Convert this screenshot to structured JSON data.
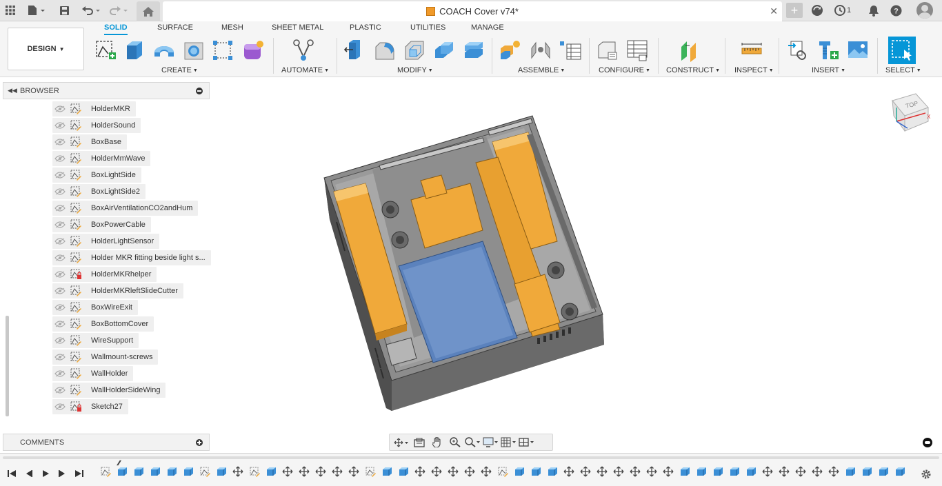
{
  "window": {
    "title": "COACH Cover v74*"
  },
  "topbar": {
    "icons": [
      "apps-grid-icon",
      "file-icon",
      "save-icon",
      "undo-icon",
      "redo-icon",
      "home-icon",
      "new-tab-icon",
      "extensions-icon",
      "job-status-icon",
      "notifications-icon",
      "help-icon",
      "avatar"
    ],
    "job_count": "1"
  },
  "ribbon": {
    "workspace": "DESIGN",
    "tabs": [
      {
        "label": "SOLID",
        "active": true
      },
      {
        "label": "SURFACE",
        "active": false
      },
      {
        "label": "MESH",
        "active": false
      },
      {
        "label": "SHEET METAL",
        "active": false
      },
      {
        "label": "PLASTIC",
        "active": false
      },
      {
        "label": "UTILITIES",
        "active": false
      },
      {
        "label": "MANAGE",
        "active": false
      }
    ],
    "groups": [
      {
        "label": "CREATE"
      },
      {
        "label": "AUTOMATE"
      },
      {
        "label": "MODIFY"
      },
      {
        "label": "ASSEMBLE"
      },
      {
        "label": "CONFIGURE"
      },
      {
        "label": "CONSTRUCT"
      },
      {
        "label": "INSPECT"
      },
      {
        "label": "INSERT"
      },
      {
        "label": "SELECT"
      }
    ]
  },
  "browser": {
    "title": "BROWSER",
    "items": [
      {
        "label": "HolderMKR",
        "locked": false
      },
      {
        "label": "HolderSound",
        "locked": false
      },
      {
        "label": "BoxBase",
        "locked": false
      },
      {
        "label": "HolderMmWave",
        "locked": false
      },
      {
        "label": "BoxLightSide",
        "locked": false
      },
      {
        "label": "BoxLightSide2",
        "locked": false
      },
      {
        "label": "BoxAirVentilationCO2andHum",
        "locked": false
      },
      {
        "label": "BoxPowerCable",
        "locked": false
      },
      {
        "label": "HolderLightSensor",
        "locked": false
      },
      {
        "label": "Holder MKR fitting beside light s...",
        "locked": false
      },
      {
        "label": "HolderMKRhelper",
        "locked": true
      },
      {
        "label": "HolderMKRleftSlideCutter",
        "locked": false
      },
      {
        "label": "BoxWireExit",
        "locked": false
      },
      {
        "label": "BoxBottomCover",
        "locked": false
      },
      {
        "label": "WireSupport",
        "locked": false
      },
      {
        "label": "Wallmount-screws",
        "locked": false
      },
      {
        "label": "WallHolder",
        "locked": false
      },
      {
        "label": "WallHolderSideWing",
        "locked": false
      },
      {
        "label": "Sketch27",
        "locked": true
      }
    ]
  },
  "comments": {
    "title": "COMMENTS"
  },
  "viewcube": {
    "face": "TOP",
    "axis_x": "X"
  },
  "colors": {
    "accent": "#0696d7",
    "part_orange": "#f0a93a",
    "part_gray": "#6f6f6f",
    "part_blue": "#5b82bd"
  }
}
